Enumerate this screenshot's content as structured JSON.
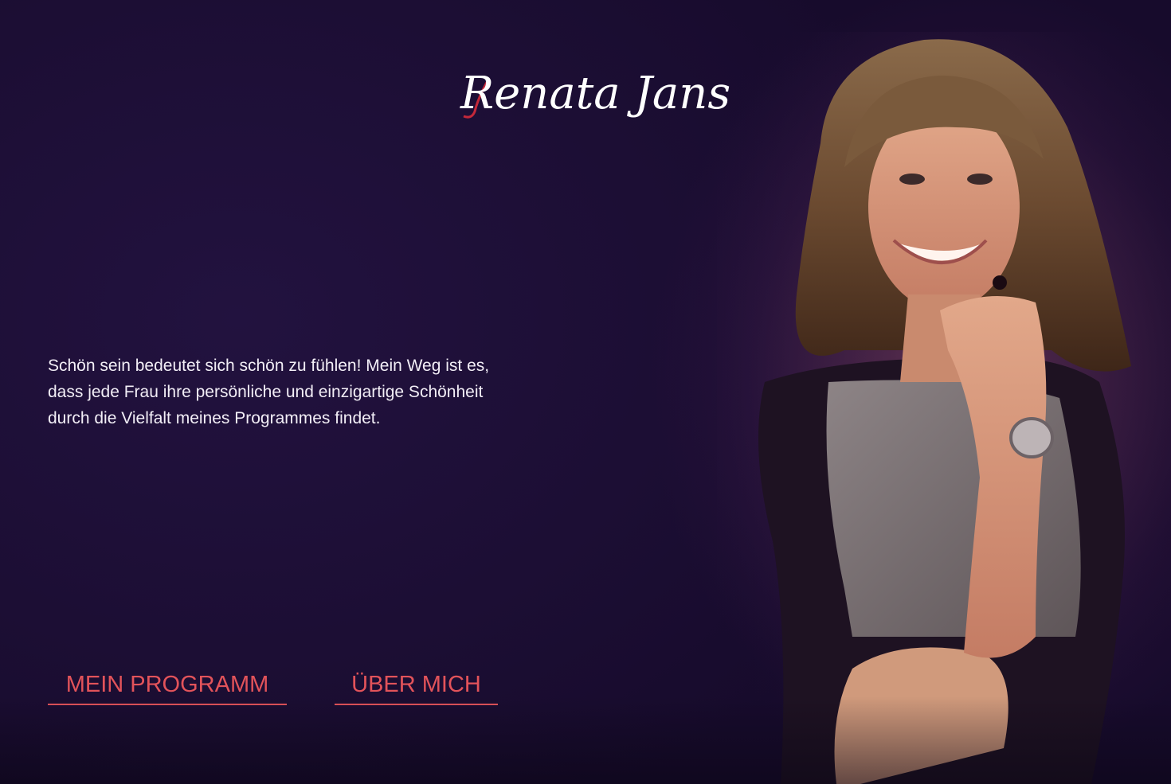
{
  "brand": {
    "logo_text": "Renata Jans"
  },
  "intro": {
    "text": "Schön sein bedeutet sich schön zu fühlen! Mein Weg ist es, dass jede Frau ihre persönliche und einzigartige Schönheit durch die Vielfalt meines Programmes findet."
  },
  "nav": {
    "programm_label": "MEIN PROGRAMM",
    "ueber_label": "ÜBER MICH"
  },
  "colors": {
    "background": "#1d0f35",
    "accent": "#e2535a",
    "text": "#f2eef6"
  },
  "images": {
    "portrait": "portrait-photo-smiling-woman"
  }
}
